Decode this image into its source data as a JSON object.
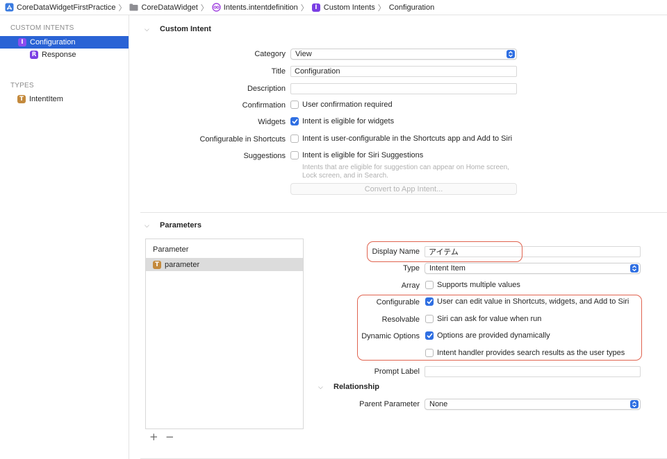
{
  "breadcrumb": [
    {
      "label": "CoreDataWidgetFirstPractice",
      "icon": "app-icon"
    },
    {
      "label": "CoreDataWidget",
      "icon": "folder-icon"
    },
    {
      "label": "Intents.intentdefinition",
      "icon": "intent-definition-icon"
    },
    {
      "label": "Custom Intents",
      "icon": "intent-badge-icon"
    },
    {
      "label": "Configuration",
      "icon": ""
    }
  ],
  "sidebar": {
    "custom_intents_header": "CUSTOM INTENTS",
    "configuration": {
      "badge": "I",
      "label": "Configuration"
    },
    "response": {
      "badge": "R",
      "label": "Response"
    },
    "types_header": "TYPES",
    "intent_item": {
      "badge": "T",
      "label": "IntentItem"
    }
  },
  "custom_intent": {
    "section_title": "Custom Intent",
    "category_label": "Category",
    "category_value": "View",
    "title_label": "Title",
    "title_value": "Configuration",
    "description_label": "Description",
    "description_value": "",
    "confirmation_label": "Confirmation",
    "confirmation_text": "User confirmation required",
    "widgets_label": "Widgets",
    "widgets_text": "Intent is eligible for widgets",
    "configurable_label": "Configurable in Shortcuts",
    "configurable_text": "Intent is user-configurable in the Shortcuts app and Add to Siri",
    "suggestions_label": "Suggestions",
    "suggestions_text": "Intent is eligible for Siri Suggestions",
    "suggestions_hint_1": "Intents that are eligible for suggestion can appear on Home screen,",
    "suggestions_hint_2": "Lock screen, and in Search.",
    "convert_button": "Convert to App Intent..."
  },
  "parameters": {
    "section_title": "Parameters",
    "table_header": "Parameter",
    "rows": [
      {
        "badge": "T",
        "name": "parameter"
      }
    ],
    "add_button": "+",
    "remove_button": "−",
    "display_name_label": "Display Name",
    "display_name_value": "アイテム",
    "type_label": "Type",
    "type_value": "Intent Item",
    "array_label": "Array",
    "array_text": "Supports multiple values",
    "configurable_label": "Configurable",
    "configurable_text": "User can edit value in Shortcuts, widgets, and Add to Siri",
    "resolvable_label": "Resolvable",
    "resolvable_text": "Siri can ask for value when run",
    "dynamic_label": "Dynamic Options",
    "dynamic_text": "Options are provided dynamically",
    "search_text": "Intent handler provides search results as the user types",
    "prompt_label": "Prompt Label",
    "prompt_value": "",
    "relationship_title": "Relationship",
    "parent_label": "Parent Parameter",
    "parent_value": "None"
  },
  "colors": {
    "accent": "#2f6fe2",
    "selection": "#2a63d5",
    "highlight": "#e0634f"
  }
}
